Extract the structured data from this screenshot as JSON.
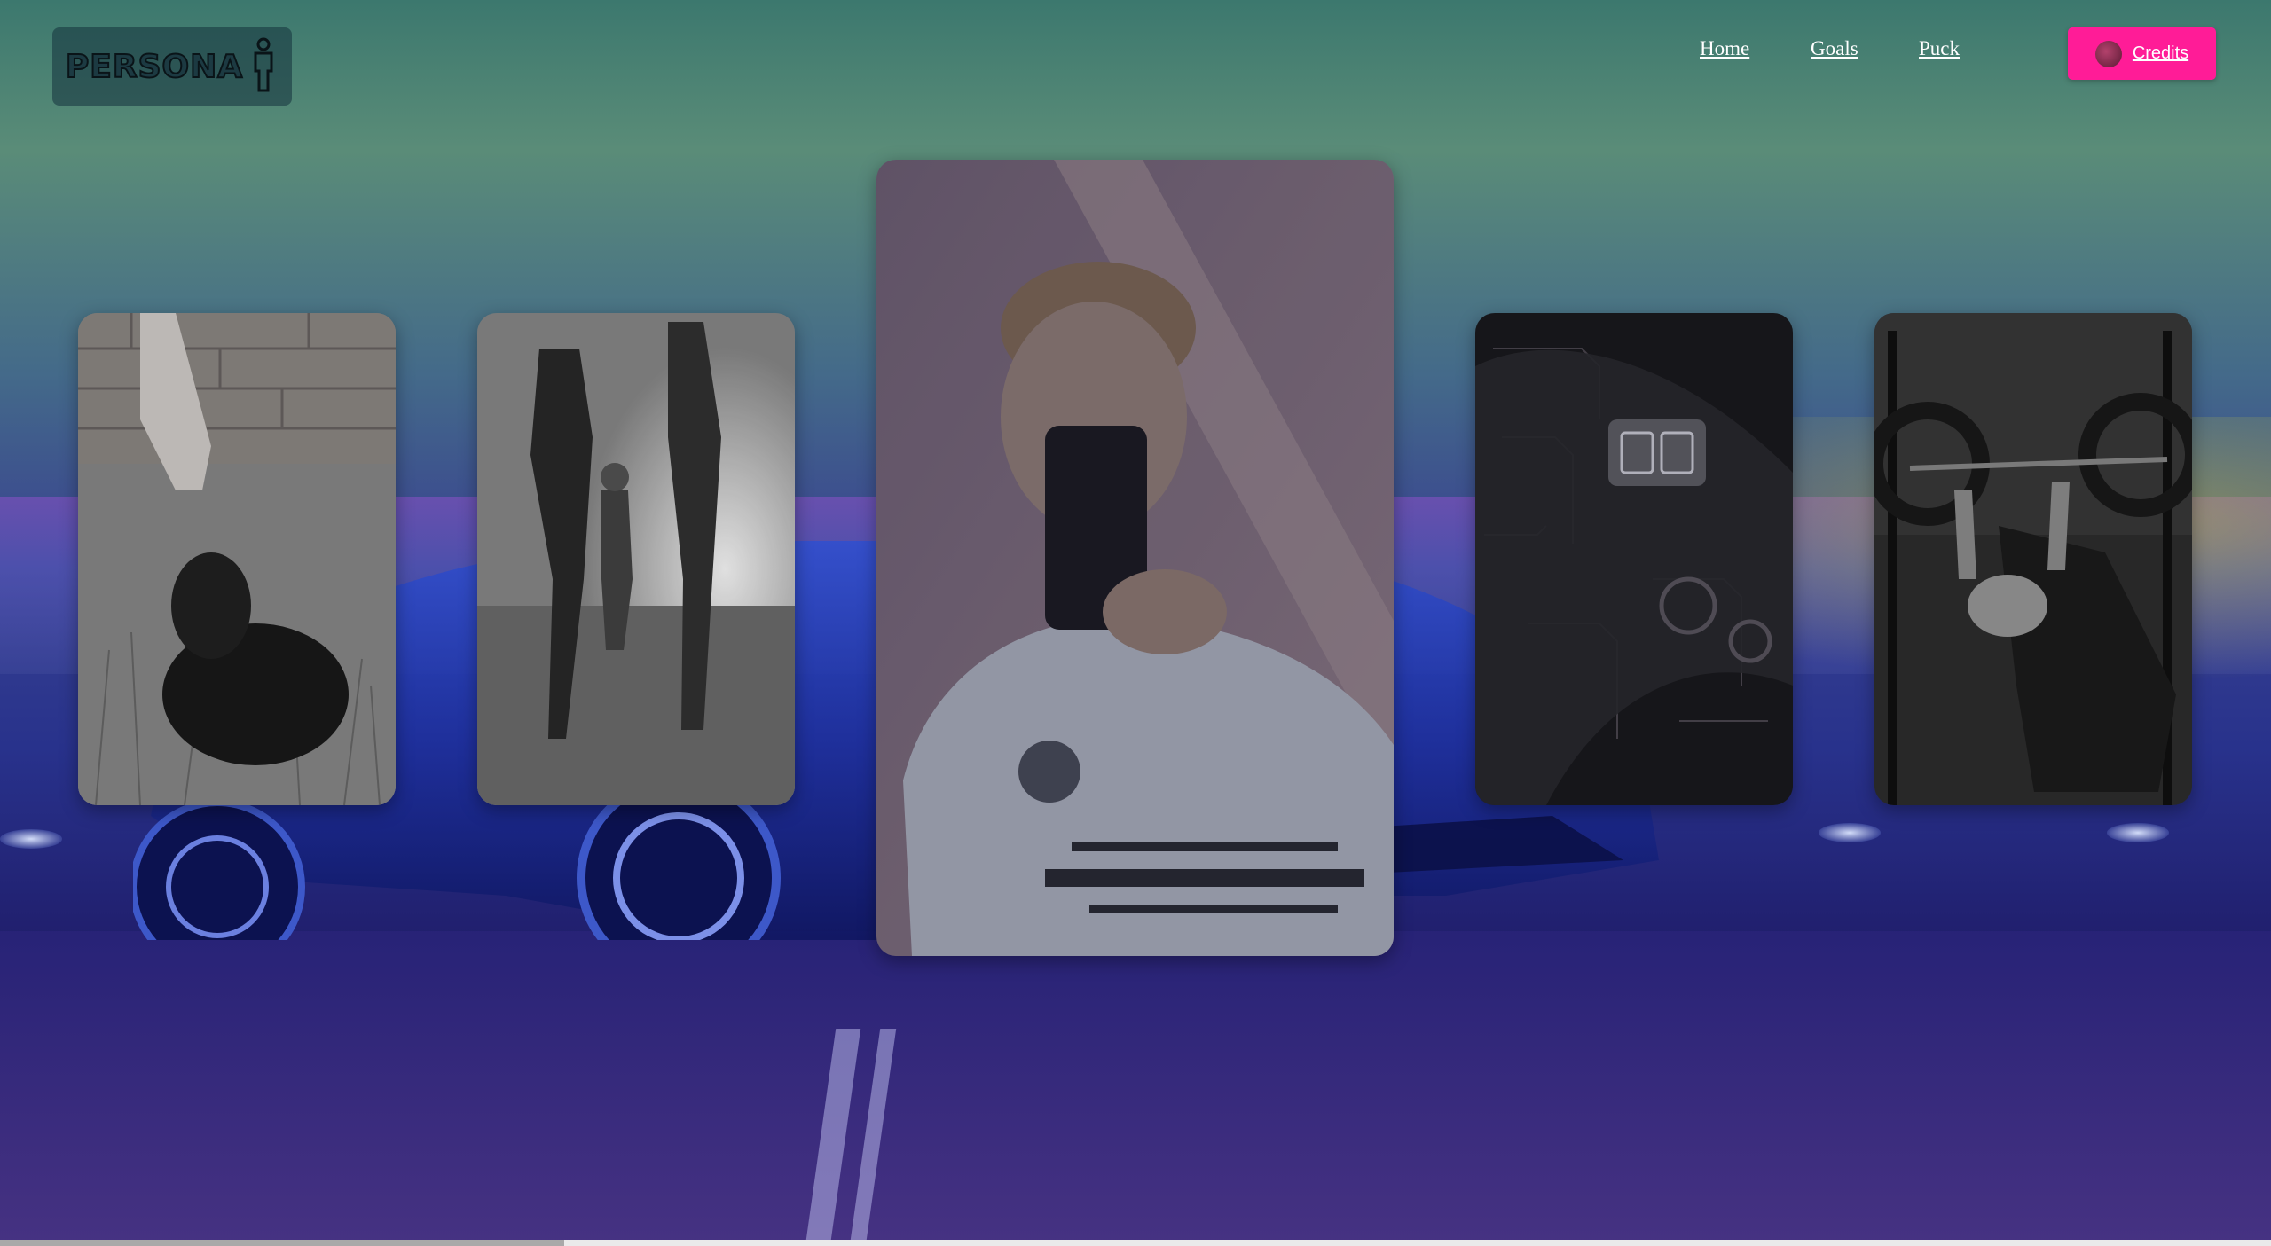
{
  "header": {
    "logo_text": "PERSONA",
    "logo_icon": "person-icon",
    "nav": [
      {
        "label": "Home"
      },
      {
        "label": "Goals"
      },
      {
        "label": "Puck"
      }
    ],
    "credits_label": "Credits",
    "credits_icon": "avatar-icon"
  },
  "carousel": {
    "cards": [
      {
        "subject": "dog-photo"
      },
      {
        "subject": "family-photo"
      },
      {
        "subject": "selfie-photo",
        "active": true
      },
      {
        "subject": "controller-photo"
      },
      {
        "subject": "gym-photo"
      }
    ]
  },
  "colors": {
    "accent": "#ff1c97",
    "nav_text": "#ffffff"
  }
}
